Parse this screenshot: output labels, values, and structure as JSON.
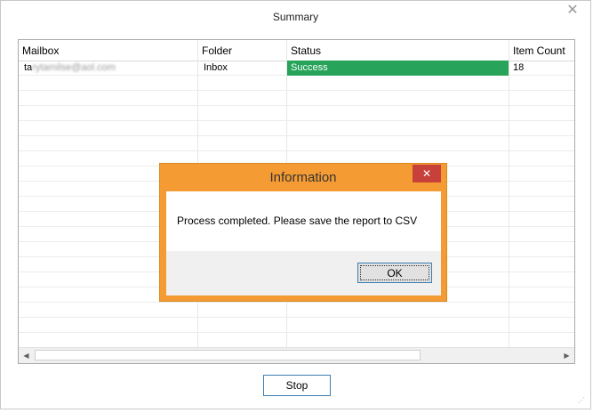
{
  "window": {
    "title": "Summary",
    "close_glyph": "✕"
  },
  "grid": {
    "columns": [
      "Mailbox",
      "Folder",
      "Status",
      "Item Count"
    ],
    "rows": [
      {
        "mailbox_prefix": "ta",
        "mailbox_rest": "rytamilse@aol.com",
        "folder": "Inbox",
        "status": "Success",
        "item_count": "18"
      }
    ]
  },
  "scrollbar": {
    "left_arrow": "◀",
    "right_arrow": "▶"
  },
  "buttons": {
    "stop": "Stop"
  },
  "dialog": {
    "title": "Information",
    "close_glyph": "✕",
    "message": "Process completed. Please save the report to CSV",
    "ok": "OK"
  },
  "icons": {
    "window_close": "close-icon",
    "dialog_close": "close-icon",
    "resize_grip": "resize-grip-icon"
  },
  "colors": {
    "status_success": "#27a35a",
    "dialog_frame": "#f59b33",
    "dialog_close": "#c7403a",
    "button_border": "#3c7fb1"
  }
}
